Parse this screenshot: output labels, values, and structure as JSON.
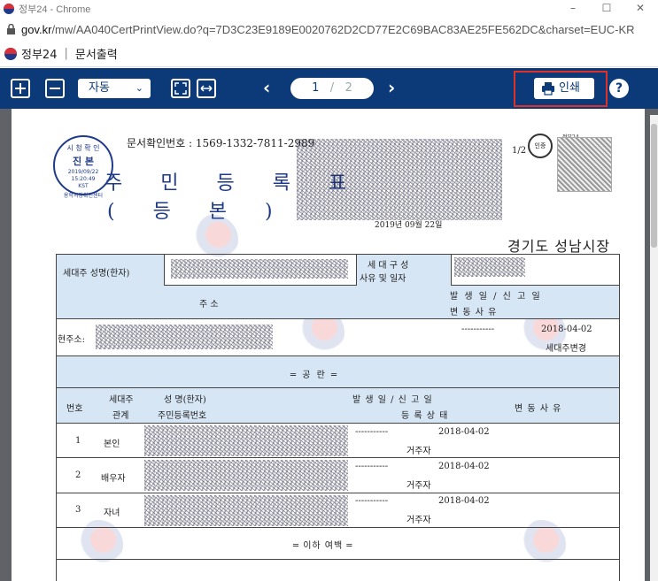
{
  "window": {
    "title": "정부24 - Chrome",
    "minimize": "–",
    "maximize": "☐",
    "close": "✕"
  },
  "address": {
    "host": "gov.kr",
    "path": "/mw/AA040CertPrintView.do?q=7D3C23E9189E0020762D2CD77E2C69BAC83AE25FE562DC&charset=EUC-KR"
  },
  "site": {
    "name": "정부24",
    "separator": "|",
    "section": "문서출력"
  },
  "toolbar": {
    "zoom_value": "자동",
    "zoom_chevron": "⌄",
    "page_current": "1",
    "page_sep": "/",
    "page_total": "2",
    "print_label": "인쇄",
    "help_label": "?",
    "prev_arrow": "‹",
    "next_arrow": "›"
  },
  "doc": {
    "doc_number": "문서확인번호 : 1569-1332-7811-2989",
    "stamp_line1": "시 청 확 인",
    "stamp_line2": "진 본",
    "stamp_line3a": "2019/09/22",
    "stamp_line3b": "15:20:49",
    "stamp_line3c": "KST",
    "stamp_line4": "용학시장확인센터",
    "title": "주 민 등 록 표",
    "subtitle": "( 등 본 )",
    "page": "1/2",
    "qr_label": "정부24",
    "seal_label": "인증",
    "issue_date": "2019년 09월 22일",
    "issuer": "경기도 성남시장",
    "household_head_label": "세대주 성명(한자)",
    "composition_label": "세 대 구 성",
    "composition_label2": "사유 및 일자",
    "addr_header": "주                      소",
    "occur_header": "발 생 일 / 신 고 일",
    "change_header": "변       동       사       유",
    "current_addr_label": "현주소:",
    "addr_dash": "-----------",
    "addr_date": "2018-04-02",
    "addr_reason": "세대주변경",
    "blank_notice": "═  공  란  ═",
    "members_header": {
      "no": "번호",
      "relation1": "세대주",
      "relation2": "관계",
      "name1": "성 명(한자)",
      "name2": "주민등록번호",
      "occur1": "발 생 일  /  신 고 일",
      "occur2": "등 록 상 태",
      "reason": "변 동 사 유"
    },
    "members": [
      {
        "no": "1",
        "relation": "본인",
        "dash": "-----------",
        "date": "2018-04-02",
        "status": "거주자"
      },
      {
        "no": "2",
        "relation": "배우자",
        "dash": "-----------",
        "date": "2018-04-02",
        "status": "거주자"
      },
      {
        "no": "3",
        "relation": "자녀",
        "dash": "-----------",
        "date": "2018-04-02",
        "status": "거주자"
      }
    ],
    "end_notice": "═ 이하 여백 ═"
  },
  "colors": {
    "toolbar_bg": "#0c3a78",
    "header_fill": "#d7e6f5",
    "highlight": "#e0302a",
    "stamp": "#1f3a8a"
  }
}
